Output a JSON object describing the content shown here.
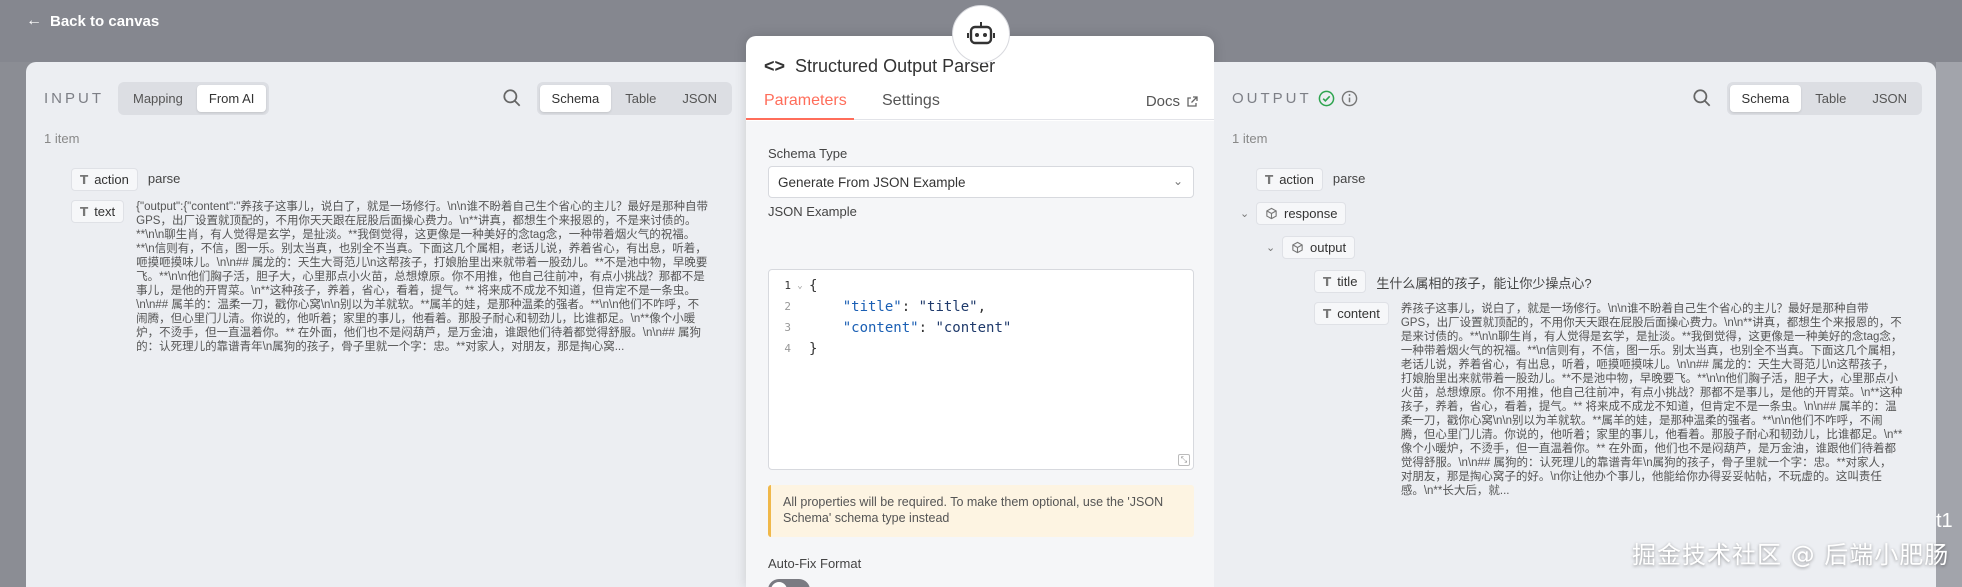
{
  "topbar": {
    "back_label": "Back to canvas"
  },
  "input": {
    "title": "INPUT",
    "mapping_options": [
      "Mapping",
      "From AI"
    ],
    "mapping_active": "From AI",
    "view_options": [
      "Schema",
      "Table",
      "JSON"
    ],
    "view_active": "Schema",
    "item_count": "1 item",
    "fields": [
      {
        "name": "action",
        "value": "parse"
      },
      {
        "name": "text",
        "value": "{\"output\":{\"content\":\"养孩子这事儿，说白了，就是一场修行。\\n\\n谁不盼着自己生个省心的主儿？最好是那种自带GPS，出厂设置就顶配的，不用你天天跟在屁股后面操心费力。\\n**讲真，都想生个来报恩的，不是来讨债的。**\\n\\n聊生肖，有人觉得是玄学，是扯淡。**我倒觉得，这更像是一种美好的念tag念，一种带着烟火气的祝福。**\\n信则有，不信，图一乐。别太当真，也别全不当真。下面这几个属相，老话儿说，养着省心，有出息，听着，咂摸咂摸味儿。\\n\\n## 属龙的：天生大哥范儿\\n这帮孩子，打娘胎里出来就带着一股劲儿。**不是池中物，早晚要飞。**\\n\\n他们胸子活，胆子大，心里那点小火苗，总想燎原。你不用推，他自己往前冲，有点小挑战？那都不是事儿，是他的开胃菜。\\n**这种孩子，养着，省心，看着，提气。** 将来成不成龙不知道，但肯定不是一条虫。\\n\\n## 属羊的：温柔一刀，戳你心窝\\n\\n别以为羊就软。**属羊的娃，是那种温柔的强者。**\\n\\n他们不咋呼，不闹腾，但心里门儿清。你说的，他听着；家里的事儿，他看着。那股子耐心和韧劲儿，比谁都足。\\n**像个小暖炉，不烫手，但一直温着你。** 在外面，他们也不是闷葫芦，是万金油，谁跟他们待着都觉得舒服。\\n\\n## 属狗的：认死理儿的靠谱青年\\n属狗的孩子，骨子里就一个字：忠。**对家人，对朋友，那是掏心窝..."
      }
    ]
  },
  "modal": {
    "title": "Structured Output Parser",
    "tabs": [
      "Parameters",
      "Settings"
    ],
    "docs_label": "Docs",
    "schema_type_label": "Schema Type",
    "schema_type_value": "Generate From JSON Example",
    "json_example_label": "JSON Example",
    "code_lines": [
      {
        "n": "1",
        "text": "{"
      },
      {
        "n": "2",
        "key": "\"title\"",
        "val": "\"title\"",
        "tail": ","
      },
      {
        "n": "3",
        "key": "\"content\"",
        "val": "\"content\"",
        "tail": ""
      },
      {
        "n": "4",
        "text": "}"
      }
    ],
    "notice": "All properties will be required. To make them optional, use the 'JSON Schema' schema type instead",
    "autofix_label": "Auto-Fix Format",
    "autofix_on": false
  },
  "output": {
    "title": "OUTPUT",
    "view_options": [
      "Schema",
      "Table",
      "JSON"
    ],
    "view_active": "Schema",
    "item_count": "1 item",
    "fields": {
      "action": {
        "name": "action",
        "value": "parse"
      },
      "response": {
        "name": "response"
      },
      "output": {
        "name": "output"
      },
      "title": {
        "name": "title",
        "value": "生什么属相的孩子，能让你少操点心?"
      },
      "content": {
        "name": "content",
        "value": "养孩子这事儿，说白了，就是一场修行。\\n\\n谁不盼着自己生个省心的主儿？最好是那种自带GPS，出厂设置就顶配的，不用你天天跟在屁股后面操心费力。\\n\\n**讲真，都想生个来报恩的，不是来讨债的。**\\n\\n聊生肖，有人觉得是玄学，是扯淡。**我倒觉得，这更像是一种美好的念tag念，一种带着烟火气的祝福。**\\n信则有，不信，图一乐。别太当真，也别全不当真。下面这几个属相，老话儿说，养着省心，有出息，听着，咂摸咂摸味儿。\\n\\n## 属龙的：天生大哥范儿\\n这帮孩子，打娘胎里出来就带着一股劲儿。**不是池中物，早晚要飞。**\\n\\n他们胸子活，胆子大，心里那点小火苗，总想燎原。你不用推，他自己往前冲，有点小挑战？那都不是事儿，是他的开胃菜。\\n**这种孩子，养着，省心，看着，提气。** 将来成不成龙不知道，但肯定不是一条虫。\\n\\n## 属羊的：温柔一刀，戳你心窝\\n\\n别以为羊就软。**属羊的娃，是那种温柔的强者。**\\n\\n他们不咋呼，不闹腾，但心里门儿清。你说的，他听着；家里的事儿，他看着。那股子耐心和韧劲儿，比谁都足。\\n**像个小暖炉，不烫手，但一直温着你。** 在外面，他们也不是闷葫芦，是万金油，谁跟他们待着都觉得舒服。\\n\\n## 属狗的：认死理儿的靠谱青年\\n属狗的孩子，骨子里就一个字：忠。**对家人，对朋友，那是掏心窝子的好。\\n你让他办个事儿，他能给你办得妥妥帖帖，不玩虚的。这叫责任感。\\n**长大后，就..."
      }
    }
  },
  "watermark": "掘金技术社区 @ 后端小肥肠",
  "edge_label": "t1",
  "colors": {
    "accent": "#ff6d5a",
    "success": "#2ea44f",
    "warning_bg": "#fdf4e2"
  }
}
